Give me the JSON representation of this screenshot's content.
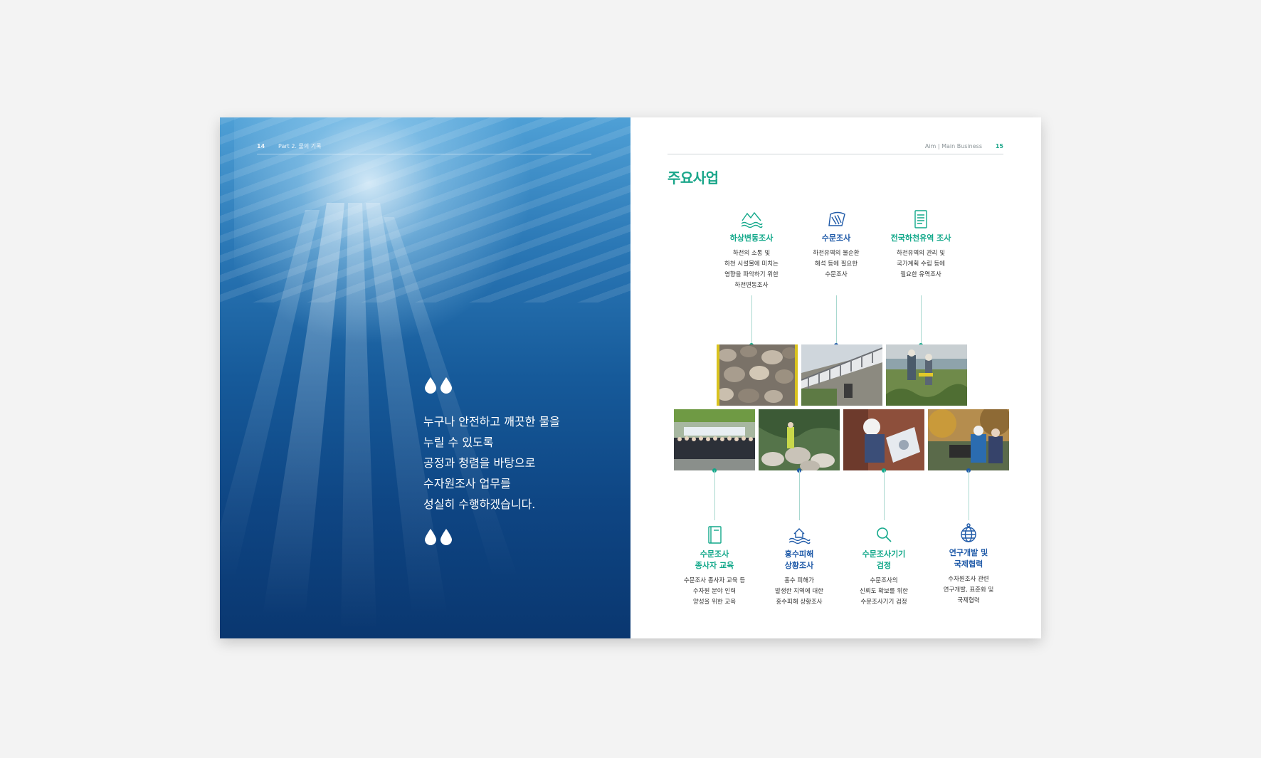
{
  "left_page": {
    "page_number": "14",
    "part_title": "Part 2. 물의 기록",
    "quote_lines": [
      "누구나 안전하고 깨끗한 물을",
      "누릴 수 있도록",
      "공정과 청렴을 바탕으로",
      "수자원조사 업무를",
      "성실히 수행하겠습니다."
    ]
  },
  "right_page": {
    "section_label": "Aim | Main Business",
    "page_number": "15",
    "title": "주요사업",
    "top_items": [
      {
        "name": "하상변동조사",
        "icon": "riverbed-icon",
        "desc": [
          "하천의 소통 및",
          "하천 시설물에 미치는",
          "영향을 파악하기 위한",
          "하천변동조사"
        ]
      },
      {
        "name": "수문조사",
        "icon": "hydrology-icon",
        "desc": [
          "하천유역의 물순환",
          "해석 등에 필요한",
          "수문조사"
        ]
      },
      {
        "name": "전국하천유역 조사",
        "icon": "document-icon",
        "desc": [
          "하천유역의 관리 및",
          "국가계획 수립 등에",
          "필요한  유역조사"
        ]
      }
    ],
    "bottom_items": [
      {
        "name": [
          "수문조사",
          "종사자 교육"
        ],
        "icon": "book-icon",
        "desc": [
          "수문조사 종사자 교육 등",
          "수자원 분야 인력",
          "양성을 위한 교육"
        ]
      },
      {
        "name": [
          "홍수피해",
          "상황조사"
        ],
        "icon": "flood-icon",
        "desc": [
          "홍수 피해가",
          "발생한 지역에 대한",
          "홍수피해 상황조사"
        ]
      },
      {
        "name": [
          "수문조사기기",
          "검정"
        ],
        "icon": "magnifier-icon",
        "desc": [
          "수문조사의",
          "신뢰도 확보를 위한",
          "수문조사기기 검정"
        ]
      },
      {
        "name": [
          "연구개발 및",
          "국제협력"
        ],
        "icon": "globe-icon",
        "desc": [
          "수자원조사 관련",
          "연구개발, 표준화 및",
          "국제협력"
        ]
      }
    ],
    "colors": {
      "teal": "#12a88a",
      "blue": "#1f5aa8"
    }
  }
}
